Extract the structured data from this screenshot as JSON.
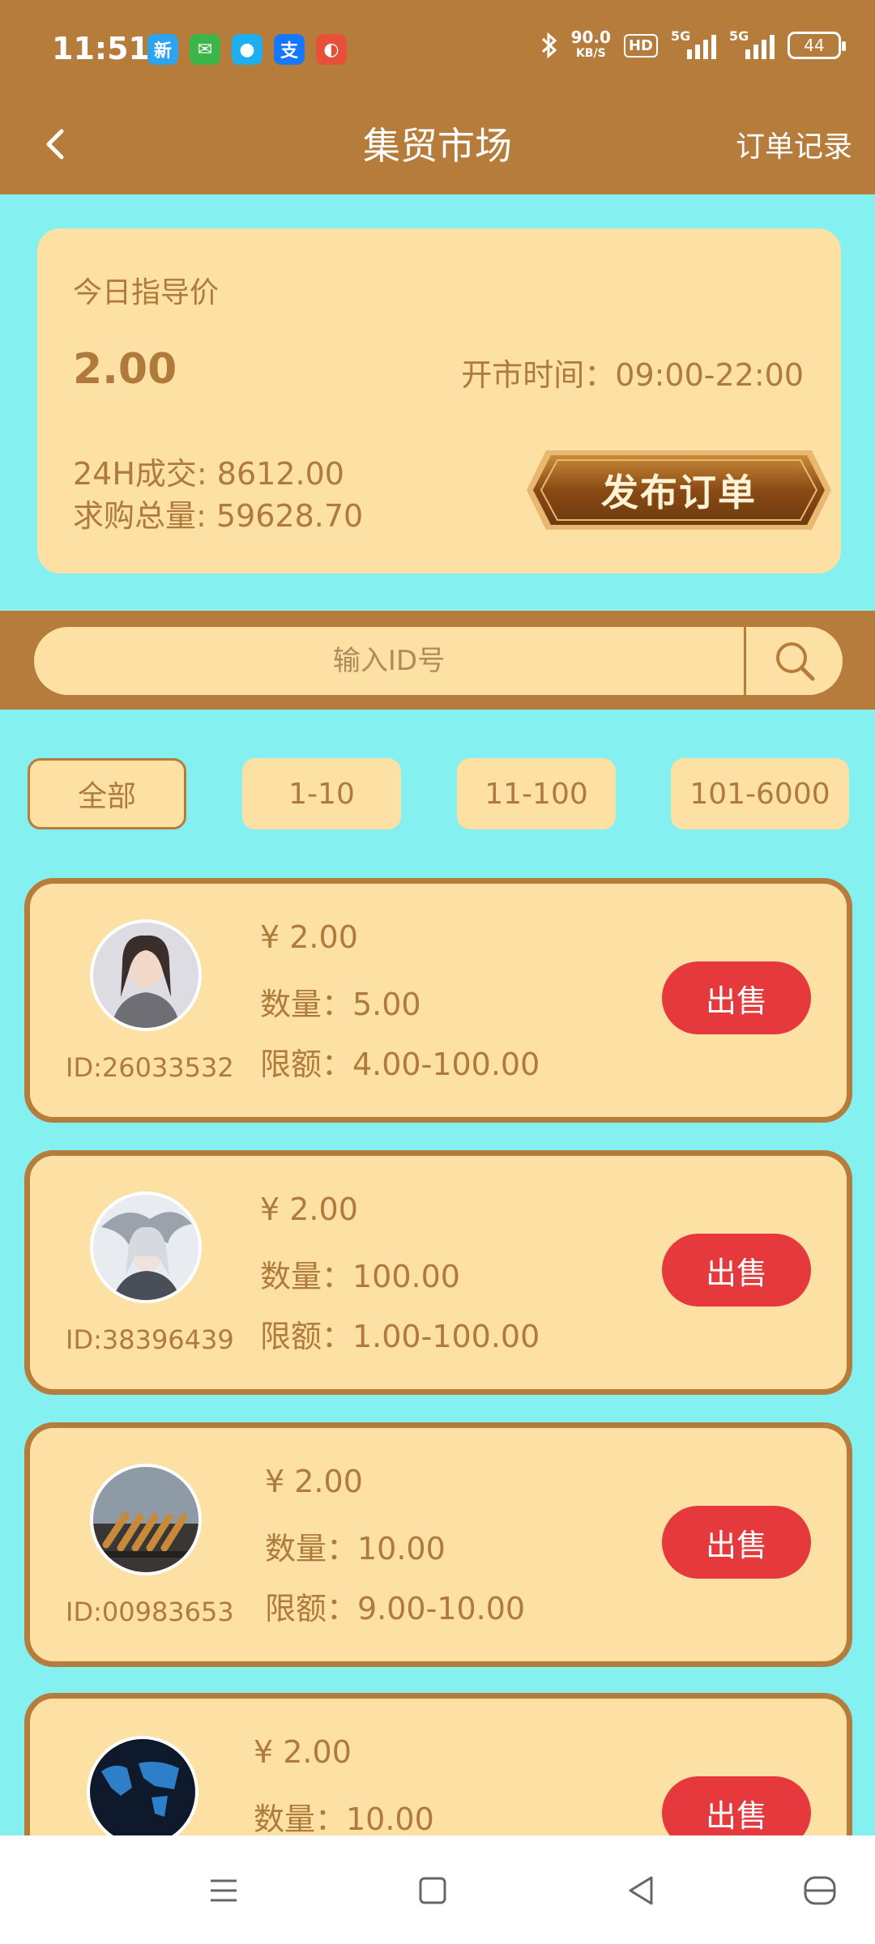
{
  "status": {
    "time": "11:51",
    "speed_value": "90.0",
    "speed_unit": "KB/S",
    "hd_label": "HD",
    "sig1": "5G",
    "sig2": "5G",
    "battery": "44",
    "apps": [
      {
        "name": "weibo-icon",
        "glyph": "新",
        "color": "#2DA4F0"
      },
      {
        "name": "wechat-icon",
        "glyph": "✉",
        "color": "#3BB54A"
      },
      {
        "name": "qq-icon",
        "glyph": "●",
        "color": "#1FAEF0"
      },
      {
        "name": "alipay-icon",
        "glyph": "支",
        "color": "#1677FF"
      },
      {
        "name": "browser-icon",
        "glyph": "◐",
        "color": "#E8503A"
      }
    ]
  },
  "header": {
    "title": "集贸市场",
    "right_link": "订单记录"
  },
  "info": {
    "guide_label": "今日指导价",
    "guide_price": "2.00",
    "open_time": "开市时间：09:00-22:00",
    "volume_24h": "24H成交: 8612.00",
    "buy_total": "求购总量: 59628.70",
    "publish_label": "发布订单"
  },
  "search": {
    "placeholder": "输入ID号"
  },
  "filters": [
    "全部",
    "1-10",
    "11-100",
    "101-6000"
  ],
  "offers": [
    {
      "id": "ID:26033532",
      "price": "¥ 2.00",
      "qty": "数量：5.00",
      "limit": "限额：4.00-100.00",
      "action": "出售"
    },
    {
      "id": "ID:38396439",
      "price": "¥ 2.00",
      "qty": "数量：100.00",
      "limit": "限额：1.00-100.00",
      "action": "出售"
    },
    {
      "id": "ID:00983653",
      "price": "¥ 2.00",
      "qty": "数量：10.00",
      "limit": "限额：9.00-10.00",
      "action": "出售"
    },
    {
      "id": "",
      "price": "¥ 2.00",
      "qty": "数量：10.00",
      "limit": "",
      "action": "出售"
    }
  ]
}
